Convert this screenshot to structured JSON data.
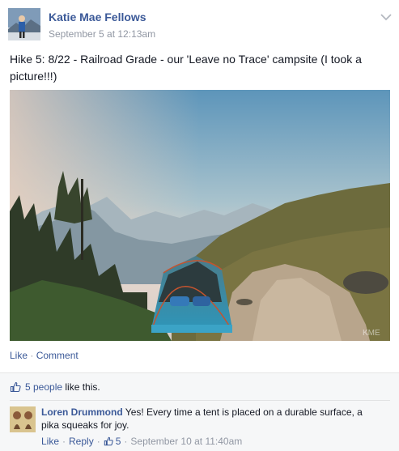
{
  "post": {
    "author": "Katie Mae Fellows",
    "timestamp": "September 5 at 12:13am",
    "text": "Hike 5: 8/22 - Railroad Grade - our 'Leave no Trace' campsite (I took a picture!!!)",
    "photo_watermark": "KME",
    "actions": {
      "like": "Like",
      "separator": "·",
      "comment": "Comment"
    }
  },
  "likes": {
    "people_link": "5 people",
    "suffix": " like this.",
    "icon": "thumbs-up-icon"
  },
  "comment": {
    "author": "Loren Drummond",
    "text": " Yes! Every time a tent is placed on a durable surface, a pika squeaks for joy.",
    "like": "Like",
    "separator": "·",
    "reply": "Reply",
    "like_count": "5",
    "timestamp": "September 10 at 11:40am"
  },
  "colors": {
    "link": "#3b5998",
    "meta": "#9197a3",
    "feedback_bg": "#f6f7f8"
  }
}
